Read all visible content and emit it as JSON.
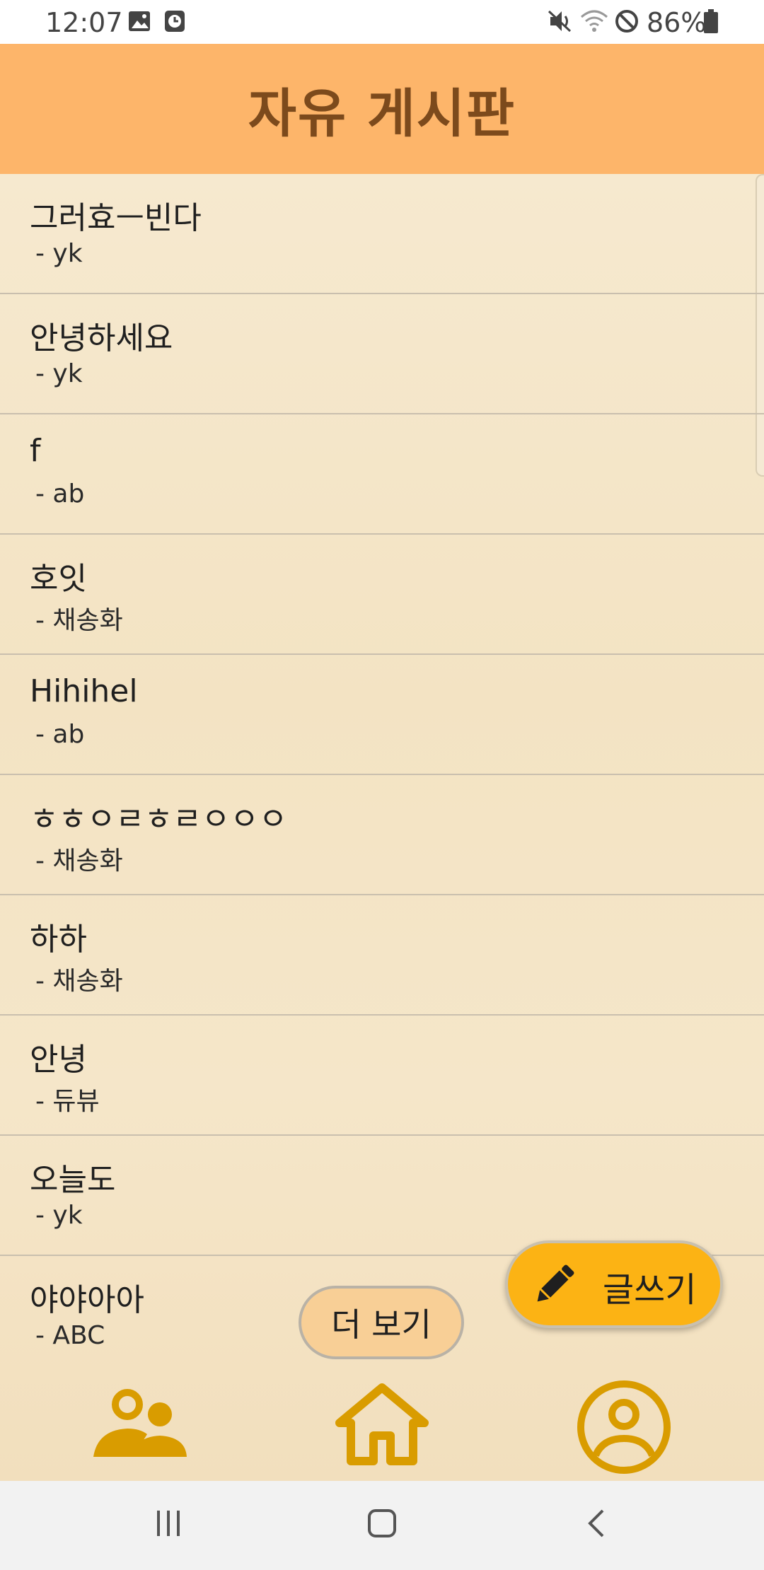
{
  "status_bar": {
    "time": "12:07",
    "battery_percent": "86%",
    "icons": [
      "gallery-icon",
      "clock-app-icon",
      "mute-icon",
      "wifi-icon",
      "do-not-disturb-icon",
      "battery-icon"
    ]
  },
  "header": {
    "title": "자유 게시판"
  },
  "posts": [
    {
      "title": "그러효ㅡ빈다",
      "author": "- yk"
    },
    {
      "title": "안녕하세요",
      "author": "- yk"
    },
    {
      "title": "f",
      "author": "- ab"
    },
    {
      "title": "호잇",
      "author": "- 채송화"
    },
    {
      "title": "Hihihel",
      "author": "- ab"
    },
    {
      "title": "ㅎㅎㅇㄹㅎㄹㅇㅇㅇ",
      "author": "- 채송화"
    },
    {
      "title": "하하",
      "author": "- 채송화"
    },
    {
      "title": "안녕",
      "author": "- 듀뷰"
    },
    {
      "title": "오늘도",
      "author": "- yk"
    },
    {
      "title": "야야아아",
      "author": "- ABC"
    }
  ],
  "buttons": {
    "more_label": "더 보기",
    "write_label": "글쓰기"
  },
  "bottom_nav": {
    "items": [
      "friends-icon",
      "home-icon",
      "profile-icon"
    ],
    "icon_color": "#d99c00"
  },
  "colors": {
    "header_bg": "#fdb56a",
    "header_text": "#7c4a1c",
    "write_button": "#fcb314",
    "more_button": "#f8cf96"
  }
}
